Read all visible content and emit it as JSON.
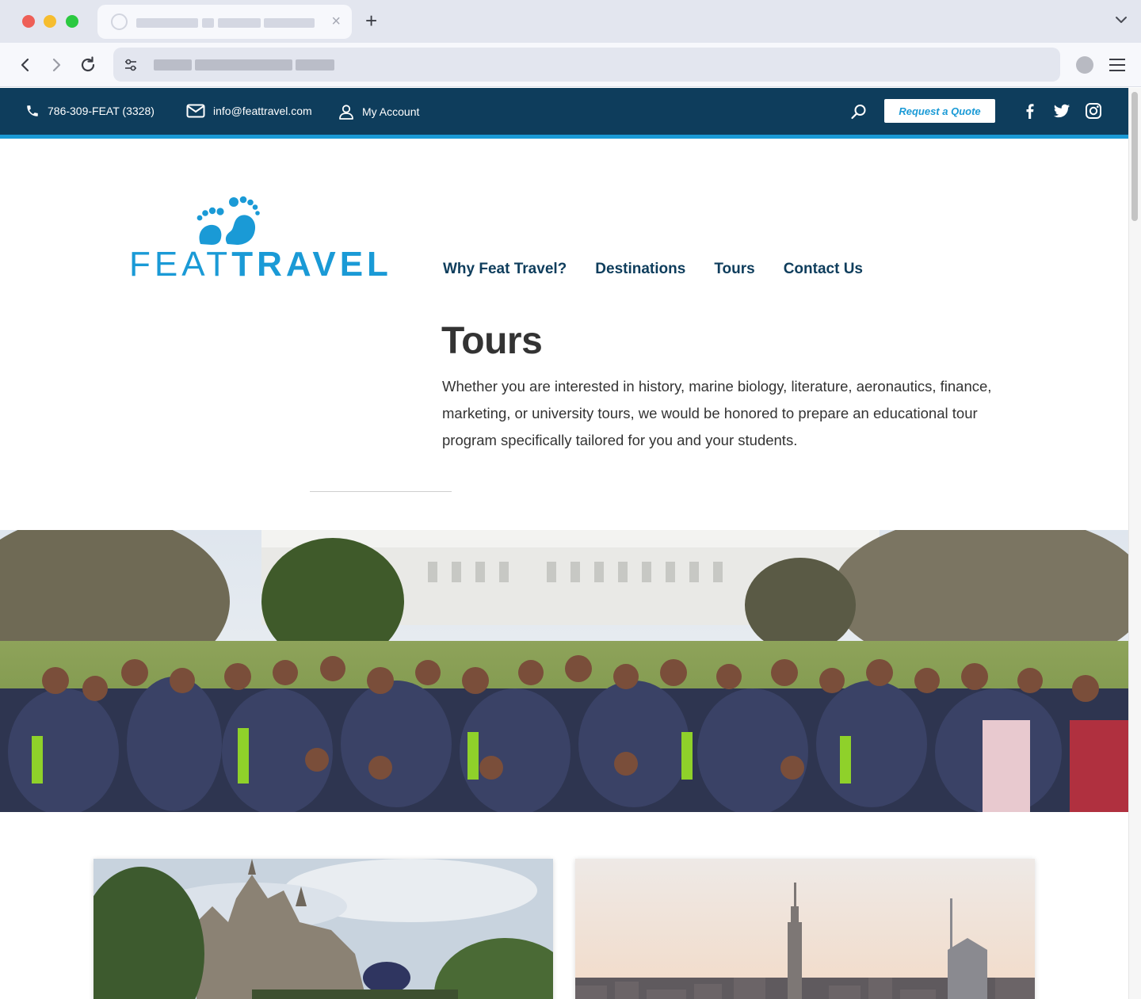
{
  "browser": {
    "tab_close": "×",
    "new_tab": "+"
  },
  "topbar": {
    "phone": "786-309-FEAT (3328)",
    "email": "info@feattravel.com",
    "account": "My Account",
    "quote_button": "Request a Quote",
    "social_icons": [
      "facebook-icon",
      "twitter-icon",
      "instagram-icon"
    ],
    "colors": {
      "bar": "#0e3d5c",
      "accent": "#1a9ad6"
    }
  },
  "logo": {
    "feat": "FEAT",
    "travel": "TRAVEL",
    "color": "#1a9ad6"
  },
  "nav": {
    "items": [
      "Why Feat Travel?",
      "Destinations",
      "Tours",
      "Contact Us"
    ]
  },
  "main": {
    "title": "Tours",
    "intro": "Whether you are interested in history, marine biology, literature, aeronautics, finance, marketing, or university tours, we would be honored to prepare an educational tour program specifically tailored for you and your students."
  }
}
